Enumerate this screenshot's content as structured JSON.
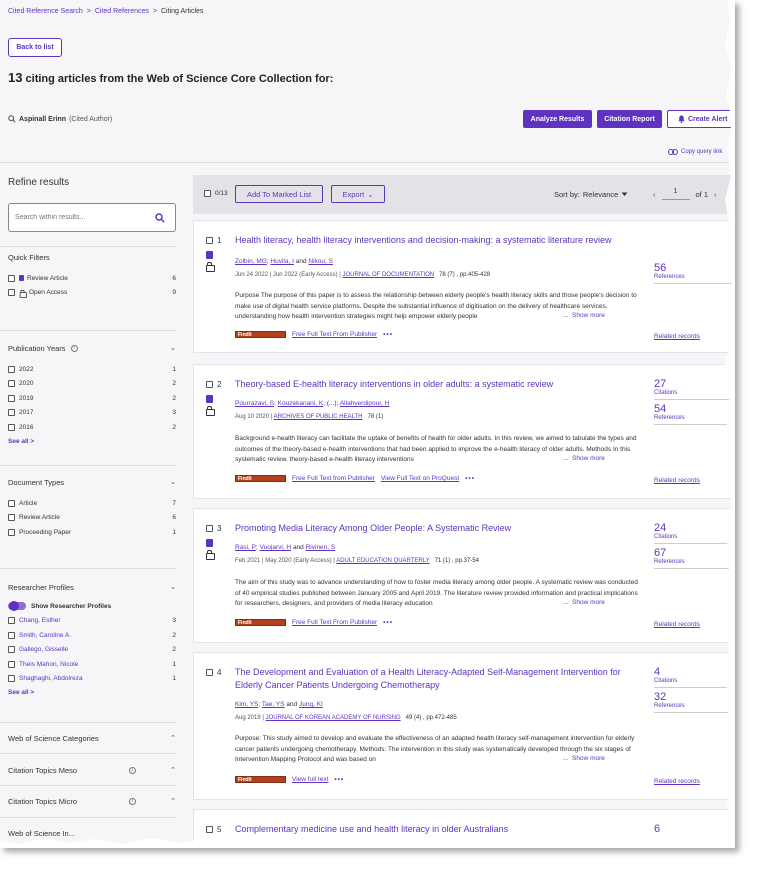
{
  "breadcrumb": [
    "Cited Reference Search",
    "Cited References",
    "Citing Articles"
  ],
  "breadcrumb_sep": ">",
  "back_button": "Back to list",
  "heading": {
    "count": "13",
    "text": " citing articles from the Web of Science Core Collection for:"
  },
  "cited_author": {
    "name": "Aspinall Erinn",
    "role": "(Cited Author)"
  },
  "actions": {
    "analyze": "Analyze Results",
    "citation_report": "Citation Report",
    "create_alert": "Create Alert",
    "copy_query": "Copy query link"
  },
  "sidebar": {
    "title": "Refine results",
    "search_placeholder": "Search within results...",
    "quick_filters": {
      "title": "Quick Filters",
      "items": [
        {
          "label": "Review Article",
          "count": "6"
        },
        {
          "label": "Open Access",
          "count": "9"
        }
      ]
    },
    "publication_years": {
      "title": "Publication Years",
      "items": [
        {
          "label": "2022",
          "count": "1"
        },
        {
          "label": "2020",
          "count": "2"
        },
        {
          "label": "2019",
          "count": "2"
        },
        {
          "label": "2017",
          "count": "3"
        },
        {
          "label": "2016",
          "count": "2"
        }
      ],
      "see_all": "See all >"
    },
    "document_types": {
      "title": "Document Types",
      "items": [
        {
          "label": "Article",
          "count": "7"
        },
        {
          "label": "Review Article",
          "count": "6"
        },
        {
          "label": "Proceeding Paper",
          "count": "1"
        }
      ]
    },
    "researcher_profiles": {
      "title": "Researcher Profiles",
      "toggle_label": "Show Researcher Profiles",
      "items": [
        {
          "label": "Chang, Esther",
          "count": "3"
        },
        {
          "label": "Smith, Caroline A.",
          "count": "2"
        },
        {
          "label": "Gallego, Gisselle",
          "count": "2"
        },
        {
          "label": "Theis Mahon, Nicole",
          "count": "1"
        },
        {
          "label": "Shaghaghi, Abdolreza",
          "count": "1"
        }
      ],
      "see_all": "See all >"
    },
    "collapsed_sections": [
      "Web of Science Categories",
      "Citation Topics Meso",
      "Citation Topics Micro",
      "Web of Science In..."
    ]
  },
  "toolbar": {
    "selected": "0/13",
    "add_marked": "Add To Marked List",
    "export": "Export",
    "sort_label": "Sort by:",
    "sort_value": "Relevance",
    "page": "1",
    "of_label": "of 1"
  },
  "results": [
    {
      "num": "1",
      "title": "Health literacy, health literacy interventions and decision-making: a systematic literature review",
      "authors": [
        "Zolbin, MG",
        "Huvila, I",
        "Nikou, S"
      ],
      "author_seps": [
        "; ",
        " and "
      ],
      "date": "Jun 24 2022 | Jun 2022 (Early Access) |",
      "journal": "JOURNAL OF DOCUMENTATION",
      "volume": "78 (7) , pp.405-428",
      "abstract": "Purpose The purpose of this paper is to assess the relationship between elderly people's health literacy skills and those people's decision to make use of digital health service platforms. Despite the substantial influence of digitisation on the delivery of healthcare services, understanding how health intervention strategies might help empower elderly people",
      "show_more": "Show more",
      "findit": "FindIt",
      "full_text": [
        "Free Full Text From Publisher"
      ],
      "stats": [
        {
          "num": "56",
          "label": "References"
        }
      ],
      "related": "Related records"
    },
    {
      "num": "2",
      "title": "Theory-based E-health literacy interventions in older adults: a systematic review",
      "authors": [
        "Pourrazavi, S",
        "Kouzekanani, K",
        "(...)",
        "Allahverdipour, H"
      ],
      "author_seps": [
        "; ",
        "; ",
        "; "
      ],
      "date": "Aug 10 2020 |",
      "journal": "ARCHIVES OF PUBLIC HEALTH",
      "volume": "78 (1)",
      "abstract": "Background e-health literacy can facilitate the uptake of benefits of health for older adults. In this review, we aimed to tabulate the types and outcomes of the theory-based e-health interventions that had been applied to improve the e-health literacy of older adults. Methods In this systematic review, theory-based e-health literacy interventions",
      "show_more": "Show more",
      "findit": "FindIt",
      "full_text": [
        "Free Full Text from Publisher",
        "View Full Text on ProQuest"
      ],
      "stats": [
        {
          "num": "27",
          "label": "Citations"
        },
        {
          "num": "54",
          "label": "References"
        }
      ],
      "related": "Related records"
    },
    {
      "num": "3",
      "title": "Promoting Media Literacy Among Older People: A Systematic Review",
      "authors": [
        "Rasi, P",
        "Vuojarvi, H",
        "Rivinen, S"
      ],
      "author_seps": [
        "; ",
        " and "
      ],
      "date": "Feb 2021 | May 2020 (Early Access) |",
      "journal": "ADULT EDUCATION QUARTERLY",
      "volume": "71 (1) , pp.37-54",
      "abstract": "The aim of this study was to advance understanding of how to foster media literacy among older people. A systematic review was conducted of 40 empirical studies published between January 2005 and April 2019. The literature review provided information and practical implications for researchers, designers, and providers of media literacy education",
      "show_more": "Show more",
      "findit": "FindIt",
      "full_text": [
        "Free Full Text From Publisher"
      ],
      "stats": [
        {
          "num": "24",
          "label": "Citations"
        },
        {
          "num": "67",
          "label": "References"
        }
      ],
      "related": "Related records"
    },
    {
      "num": "4",
      "title": "The Development and Evaluation of a Health Literacy-Adapted Self-Management Intervention for Elderly Cancer Patients Undergoing Chemotherapy",
      "authors": [
        "Kim, YS",
        "Tae, YS",
        "Jung, KI"
      ],
      "author_seps": [
        "; ",
        " and "
      ],
      "date": "Aug 2019 |",
      "journal": "JOURNAL OF KOREAN ACADEMY OF NURSING",
      "volume": "49 (4) , pp.472-485",
      "abstract": "Purpose: This study aimed to develop and evaluate the effectiveness of an adapted health literacy self-management intervention for elderly cancer patients undergoing chemotherapy. Methods: The intervention in this study was systematically developed through the six stages of Intervention Mapping Protocol and was based on",
      "show_more": "Show more",
      "findit": "FindIt",
      "full_text": [
        "View full text"
      ],
      "stats": [
        {
          "num": "4",
          "label": "Citations"
        },
        {
          "num": "32",
          "label": "References"
        }
      ],
      "related": "Related records"
    },
    {
      "num": "5",
      "title": "Complementary medicine use and health literacy in older Australians",
      "stats": [
        {
          "num": "6",
          "label": ""
        }
      ]
    }
  ]
}
